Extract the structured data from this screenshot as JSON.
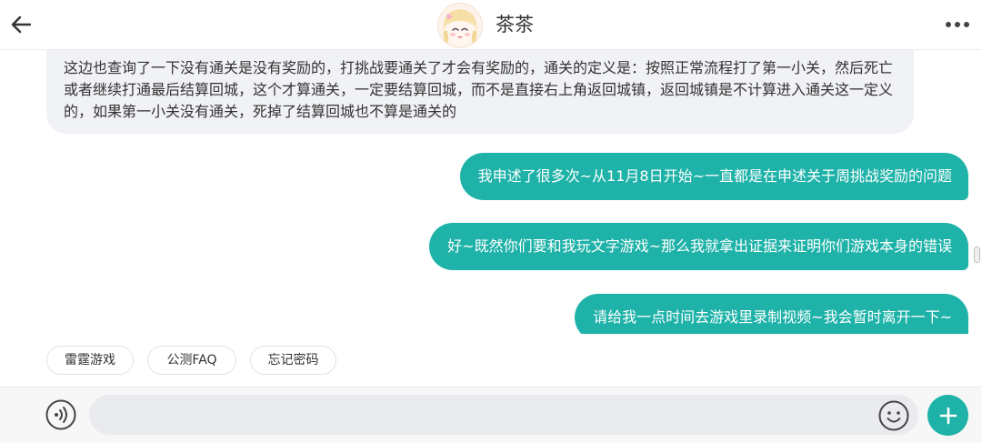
{
  "header": {
    "title": "茶茶"
  },
  "messages": {
    "incoming": "这边也查询了一下没有通关是没有奖励的，打挑战要通关了才会有奖励的，通关的定义是：按照正常流程打了第一小关，然后死亡或者继续打通最后结算回城，这个才算通关，一定要结算回城，而不是直接右上角返回城镇，返回城镇是不计算进入通关这一定义的，如果第一小关没有通关，死掉了结算回城也不算是通关的",
    "outgoing": [
      "我申述了很多次~从11月8日开始~一直都是在申述关于周挑战奖励的问题",
      "好~既然你们要和我玩文字游戏~那么我就拿出证据来证明你们游戏本身的错误",
      "请给我一点时间去游戏里录制视频~我会暂时离开一下~"
    ]
  },
  "quick_replies": [
    "雷霆游戏",
    "公测FAQ",
    "忘记密码"
  ],
  "input": {
    "value": "",
    "placeholder": ""
  },
  "colors": {
    "accent": "#1eb2a8",
    "incoming_bubble": "#f0f2f5",
    "input_field": "#e9ebef"
  },
  "icons": {
    "back": "arrow-left-icon",
    "more": "more-dots-icon",
    "voice": "voice-icon",
    "emoji": "emoji-icon",
    "plus": "plus-icon"
  }
}
